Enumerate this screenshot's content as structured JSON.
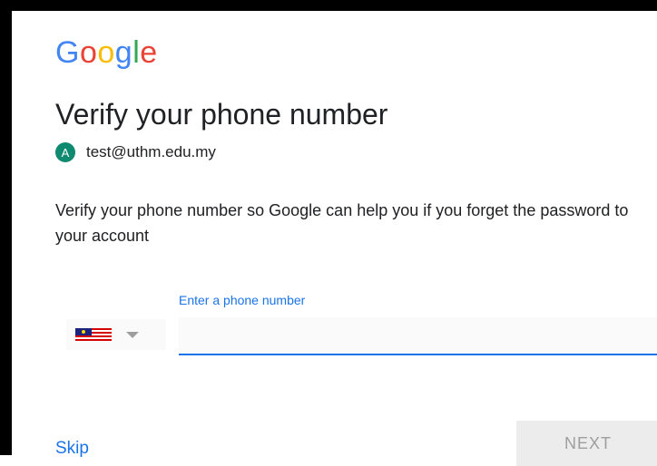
{
  "brand": {
    "logo_letters": [
      "G",
      "o",
      "o",
      "g",
      "l",
      "e"
    ],
    "logo_colors": [
      "#4285F4",
      "#EA4335",
      "#FBBC05",
      "#4285F4",
      "#34A853",
      "#EA4335"
    ]
  },
  "page": {
    "title": "Verify your phone number"
  },
  "account": {
    "avatar_initial": "A",
    "email": "test@uthm.edu.my",
    "avatar_color": "#0f8a72"
  },
  "description": "Verify your phone number so Google can help you if you forget the password to your account",
  "phone_field": {
    "label": "Enter a phone number",
    "value": "",
    "country_flag_icon": "malaysia-flag-icon",
    "dropdown_icon": "caret-down-icon"
  },
  "actions": {
    "skip_label": "Skip",
    "next_label": "NEXT"
  },
  "colors": {
    "accent": "#1a73e8",
    "text": "#202124",
    "disabled_button_bg": "#ececec",
    "disabled_button_text": "#9e9e9e"
  }
}
